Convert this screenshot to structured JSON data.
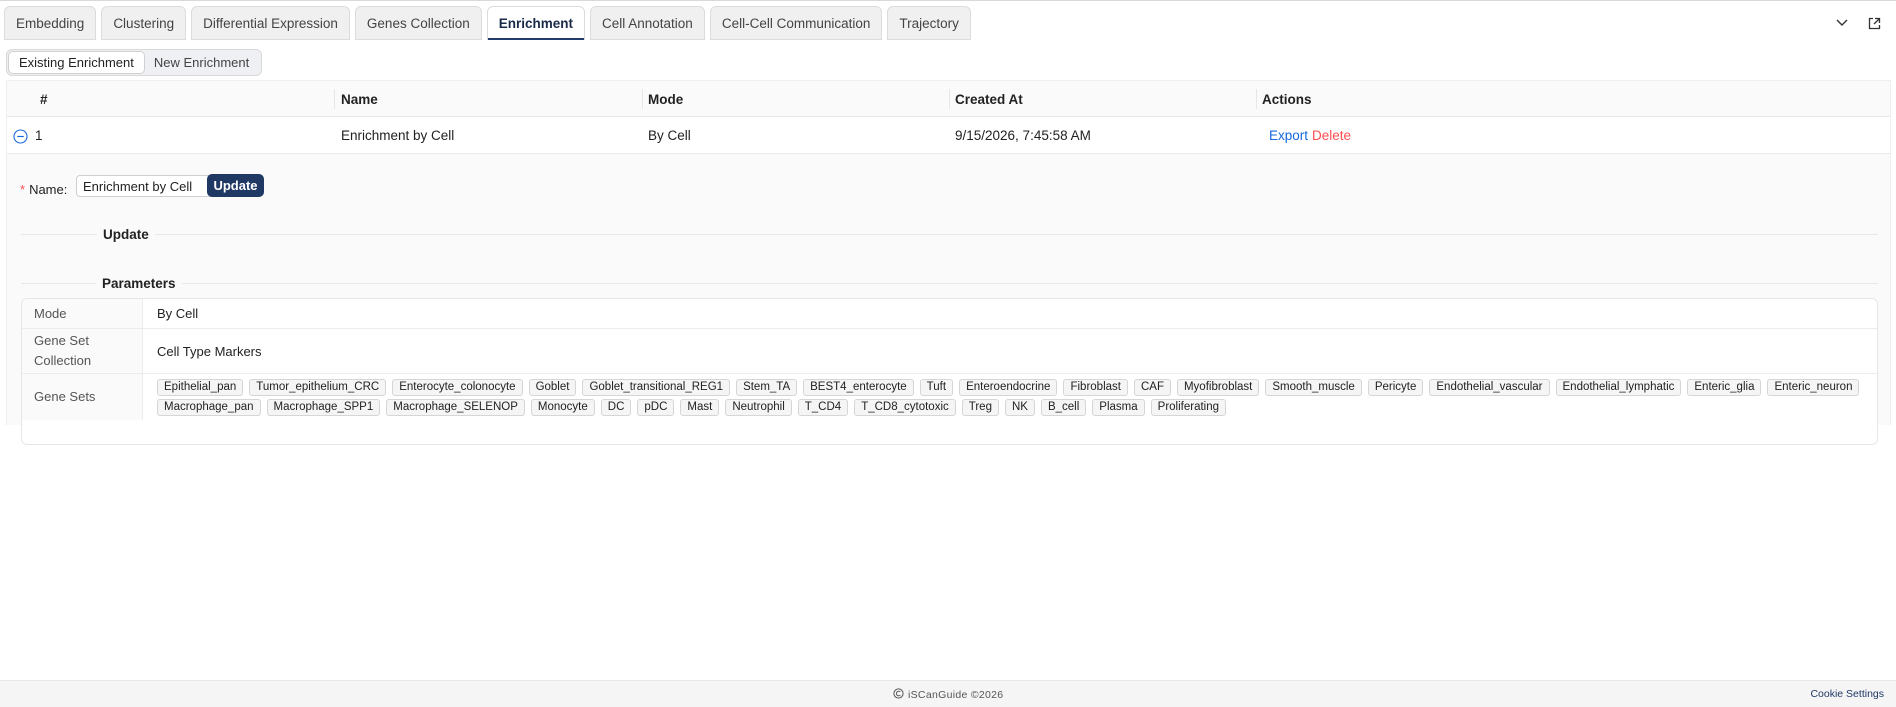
{
  "tabs": [
    "Embedding",
    "Clustering",
    "Differential Expression",
    "Genes Collection",
    "Enrichment",
    "Cell Annotation",
    "Cell-Cell Communication",
    "Trajectory"
  ],
  "active_tab": "Enrichment",
  "segmented": {
    "existing": "Existing Enrichment",
    "new": "New Enrichment"
  },
  "table": {
    "headers": {
      "index": "#",
      "name": "Name",
      "mode": "Mode",
      "created_at": "Created At",
      "actions": "Actions"
    },
    "rows": [
      {
        "index": "1",
        "name": "Enrichment by Cell",
        "mode": "By Cell",
        "created_at": "9/15/2026, 7:45:58 AM",
        "export": "Export",
        "delete": "Delete"
      }
    ]
  },
  "expanded": {
    "update_title": "Update",
    "name_label": "Name",
    "name_value": "Enrichment by Cell",
    "update_button": "Update",
    "parameters_title": "Parameters",
    "params": {
      "mode_label": "Mode",
      "mode_value": "By Cell",
      "collection_label": "Gene Set Collection",
      "collection_value": "Cell Type Markers",
      "gene_sets_label": "Gene Sets",
      "gene_sets": [
        "Epithelial_pan",
        "Tumor_epithelium_CRC",
        "Enterocyte_colonocyte",
        "Goblet",
        "Goblet_transitional_REG1",
        "Stem_TA",
        "BEST4_enterocyte",
        "Tuft",
        "Enteroendocrine",
        "Fibroblast",
        "CAF",
        "Myofibroblast",
        "Smooth_muscle",
        "Pericyte",
        "Endothelial_vascular",
        "Endothelial_lymphatic",
        "Enteric_glia",
        "Enteric_neuron",
        "Macrophage_pan",
        "Macrophage_SPP1",
        "Macrophage_SELENOP",
        "Monocyte",
        "DC",
        "pDC",
        "Mast",
        "Neutrophil",
        "T_CD4",
        "T_CD8_cytotoxic",
        "Treg",
        "NK",
        "B_cell",
        "Plasma",
        "Proliferating"
      ]
    }
  },
  "footer": {
    "brand": "iSCanGuide ©2026",
    "cookie": "Cookie Settings"
  },
  "icons": {
    "collapse": "chevron-down-icon",
    "popout": "external-link-icon",
    "row_toggle": "minus-circle-icon",
    "brand": "brand-logo-icon"
  },
  "colors": {
    "accent": "#243b6b",
    "link": "#1668dc",
    "danger": "#ff4d4f",
    "button": "#1f3864"
  }
}
